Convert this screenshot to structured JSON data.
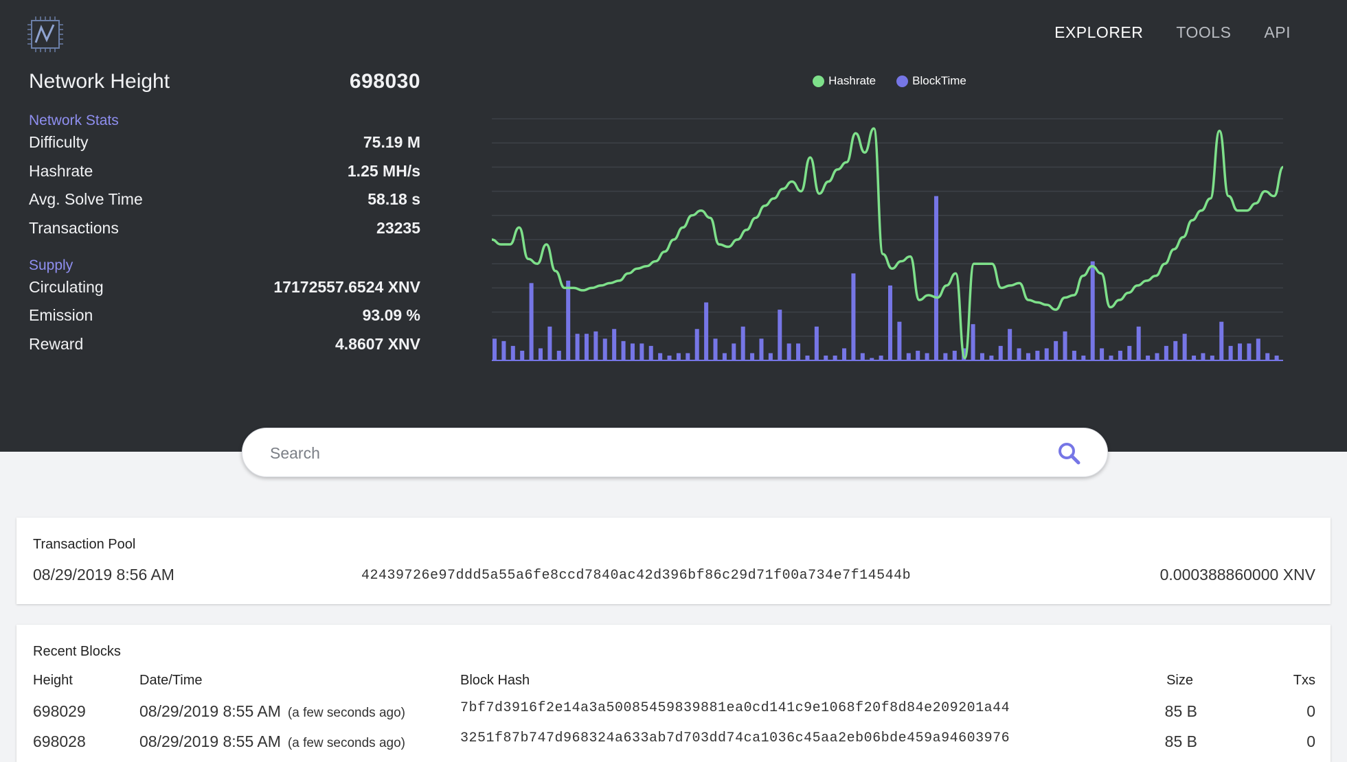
{
  "nav": {
    "items": [
      "EXPLORER",
      "TOOLS",
      "API"
    ],
    "active": "EXPLORER"
  },
  "stats": {
    "network_height_label": "Network Height",
    "network_height_value": "698030",
    "network_stats_title": "Network Stats",
    "difficulty_label": "Difficulty",
    "difficulty_value": "75.19 M",
    "hashrate_label": "Hashrate",
    "hashrate_value": "1.25 MH/s",
    "solve_label": "Avg. Solve Time",
    "solve_value": "58.18 s",
    "tx_label": "Transactions",
    "tx_value": "23235",
    "supply_title": "Supply",
    "circulating_label": "Circulating",
    "circulating_value": "17172557.6524 XNV",
    "emission_label": "Emission",
    "emission_value": "93.09 %",
    "reward_label": "Reward",
    "reward_value": "4.8607 XNV"
  },
  "chart_data": {
    "type": "line",
    "series": [
      {
        "name": "Hashrate",
        "color": "#7ee08a",
        "values": [
          50,
          48,
          48,
          55,
          42,
          40,
          48,
          37,
          30,
          30,
          29,
          30,
          31,
          32,
          33,
          36,
          38,
          39,
          41,
          45,
          50,
          55,
          60,
          62,
          59,
          48,
          47,
          50,
          54,
          59,
          64,
          67,
          71,
          74,
          70,
          84,
          69,
          74,
          79,
          82,
          94,
          86,
          96,
          44,
          38,
          41,
          43,
          25,
          27,
          26,
          31,
          36,
          1,
          40,
          40,
          40,
          30,
          31,
          32,
          25,
          24,
          23,
          21,
          26,
          27,
          35,
          39,
          36,
          22,
          25,
          28,
          31,
          33,
          35,
          40,
          46,
          51,
          58,
          62,
          67,
          95,
          68,
          62,
          62,
          65,
          70,
          68,
          80
        ]
      },
      {
        "name": "BlockTime",
        "color": "#7676e6",
        "values": [
          9,
          8,
          6,
          4,
          32,
          5,
          14,
          4,
          33,
          11,
          11,
          12,
          9,
          13,
          8,
          7,
          7,
          6,
          3,
          2,
          3,
          3,
          13,
          24,
          9,
          3,
          7,
          14,
          3,
          9,
          3,
          21,
          7,
          7,
          2,
          14,
          2,
          2,
          5,
          36,
          3,
          1,
          2,
          31,
          16,
          3,
          4,
          3,
          68,
          3,
          4,
          5,
          15,
          3,
          2,
          6,
          13,
          5,
          3,
          4,
          5,
          8,
          12,
          4,
          2,
          41,
          5,
          2,
          4,
          6,
          14,
          2,
          3,
          6,
          8,
          11,
          2,
          3,
          2,
          16,
          6,
          7,
          7,
          9,
          3,
          2
        ]
      }
    ],
    "legend_position": "top-center",
    "grid": true
  },
  "search": {
    "placeholder": "Search"
  },
  "pool": {
    "title": "Transaction Pool",
    "date": "08/29/2019 8:56 AM",
    "hash": "42439726e97ddd5a55a6fe8ccd7840ac42d396bf86c29d71f00a734e7f14544b",
    "amount": "0.000388860000 XNV"
  },
  "blocks": {
    "title": "Recent Blocks",
    "columns": [
      "Height",
      "Date/Time",
      "Block Hash",
      "Size",
      "Txs"
    ],
    "rows": [
      {
        "height": "698029",
        "date": "08/29/2019 8:55 AM",
        "ago": "(a few seconds ago)",
        "hash": "7bf7d3916f2e14a3a50085459839881ea0cd141c9e1068f20f8d84e209201a44",
        "size": "85 B",
        "txs": "0"
      },
      {
        "height": "698028",
        "date": "08/29/2019 8:55 AM",
        "ago": "(a few seconds ago)",
        "hash": "3251f87b747d968324a633ab7d703dd74ca1036c45aa2eb06bde459a94603976",
        "size": "85 B",
        "txs": "0"
      }
    ]
  }
}
